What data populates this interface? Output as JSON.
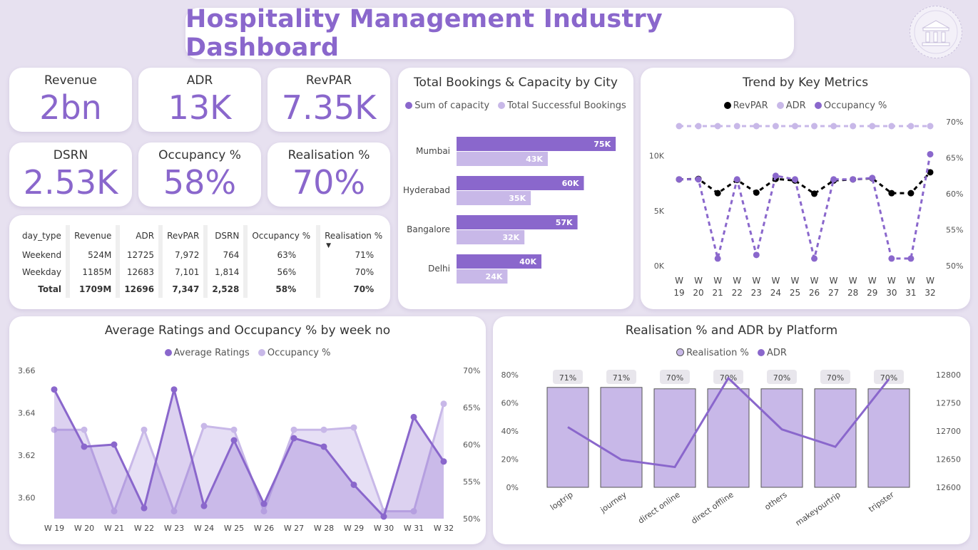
{
  "title": "Hospitality Management Industry Dashboard",
  "logo_icon": "bank-building-icon",
  "kpis": [
    {
      "label": "Revenue",
      "value": "2bn"
    },
    {
      "label": "ADR",
      "value": "13K"
    },
    {
      "label": "RevPAR",
      "value": "7.35K"
    },
    {
      "label": "DSRN",
      "value": "2.53K"
    },
    {
      "label": "Occupancy %",
      "value": "58%"
    },
    {
      "label": "Realisation %",
      "value": "70%"
    }
  ],
  "day_table": {
    "headers": [
      "day_type",
      "Revenue",
      "ADR",
      "RevPAR",
      "DSRN",
      "Occupancy %",
      "Realisation %"
    ],
    "rows": [
      [
        "Weekend",
        "524M",
        "12725",
        "7,972",
        "764",
        "63%",
        "71%"
      ],
      [
        "Weekday",
        "1185M",
        "12683",
        "7,101",
        "1,814",
        "56%",
        "70%"
      ],
      [
        "Total",
        "1709M",
        "12696",
        "7,347",
        "2,528",
        "58%",
        "70%"
      ]
    ]
  },
  "colors": {
    "accent": "#8a67cc",
    "light": "#c8b8e8",
    "black": "#000000"
  },
  "chart_data": [
    {
      "type": "bar",
      "title": "Total Bookings & Capacity by City",
      "categories": [
        "Mumbai",
        "Hyderabad",
        "Bangalore",
        "Delhi"
      ],
      "series": [
        {
          "name": "Sum of capacity",
          "values": [
            75,
            60,
            57,
            40
          ],
          "labels": [
            "75K",
            "60K",
            "57K",
            "40K"
          ]
        },
        {
          "name": "Total Successful Bookings",
          "values": [
            43,
            35,
            32,
            24
          ],
          "labels": [
            "43K",
            "35K",
            "32K",
            "24K"
          ]
        }
      ],
      "orientation": "horizontal",
      "xlim": [
        0,
        80
      ]
    },
    {
      "type": "line",
      "title": "Trend by Key Metrics",
      "categories": [
        "W 19",
        "W 20",
        "W 21",
        "W 22",
        "W 23",
        "W 24",
        "W 25",
        "W 26",
        "W 27",
        "W 28",
        "W 29",
        "W 30",
        "W 31",
        "W 32"
      ],
      "series": [
        {
          "name": "RevPAR",
          "axis": "left",
          "values": [
            7850,
            7900,
            6600,
            7800,
            6650,
            7900,
            7750,
            6550,
            7750,
            7850,
            7950,
            6600,
            6600,
            8500
          ]
        },
        {
          "name": "ADR",
          "axis": "left",
          "values": [
            12700,
            12700,
            12700,
            12700,
            12700,
            12700,
            12700,
            12700,
            12700,
            12700,
            12700,
            12700,
            12700,
            12700
          ]
        },
        {
          "name": "Occupancy %",
          "axis": "right",
          "values": [
            62,
            62,
            51,
            62,
            51.5,
            62.5,
            62,
            51,
            62,
            62,
            62.2,
            51,
            51,
            65.5
          ]
        }
      ],
      "ylim_left": [
        0,
        12700
      ],
      "yticks_left": [
        "0K",
        "5K",
        "10K"
      ],
      "ylim_right": [
        50,
        70
      ],
      "yticks_right": [
        "50%",
        "55%",
        "60%",
        "65%",
        "70%"
      ]
    },
    {
      "type": "area",
      "title": "Average Ratings and Occupancy % by week no",
      "categories": [
        "W 19",
        "W 20",
        "W 21",
        "W 22",
        "W 23",
        "W 24",
        "W 25",
        "W 26",
        "W 27",
        "W 28",
        "W 29",
        "W 30",
        "W 31",
        "W 32"
      ],
      "series": [
        {
          "name": "Average Ratings",
          "axis": "left",
          "values": [
            3.651,
            3.624,
            3.625,
            3.595,
            3.651,
            3.596,
            3.627,
            3.597,
            3.628,
            3.624,
            3.606,
            3.591,
            3.638,
            3.617
          ]
        },
        {
          "name": "Occupancy %",
          "axis": "right",
          "values": [
            62,
            62,
            51,
            62,
            51,
            62.5,
            62,
            51,
            62,
            62,
            62.3,
            51,
            51,
            65.5
          ]
        }
      ],
      "ylim_left": [
        3.59,
        3.66
      ],
      "yticks_left": [
        "3.60",
        "3.62",
        "3.64",
        "3.66"
      ],
      "ylim_right": [
        50,
        70
      ],
      "yticks_right": [
        "50%",
        "55%",
        "60%",
        "65%",
        "70%"
      ]
    },
    {
      "type": "bar",
      "title": "Realisation % and ADR by Platform",
      "categories": [
        "logtrip",
        "journey",
        "direct online",
        "direct offline",
        "others",
        "makeyourtrip",
        "tripster"
      ],
      "series": [
        {
          "name": "Realisation %",
          "axis": "left",
          "values": [
            71,
            71,
            70,
            70,
            70,
            70,
            70
          ],
          "labels": [
            "71%",
            "71%",
            "70%",
            "70%",
            "70%",
            "70%",
            "70%"
          ]
        },
        {
          "name": "ADR",
          "axis": "right",
          "type": "line",
          "values": [
            12707,
            12649,
            12636,
            12794,
            12703,
            12672,
            12792
          ]
        }
      ],
      "ylim_left": [
        0,
        80
      ],
      "yticks_left": [
        "0%",
        "20%",
        "40%",
        "60%",
        "80%"
      ],
      "ylim_right": [
        12600,
        12800
      ],
      "yticks_right": [
        "12600",
        "12650",
        "12700",
        "12750",
        "12800"
      ]
    }
  ]
}
